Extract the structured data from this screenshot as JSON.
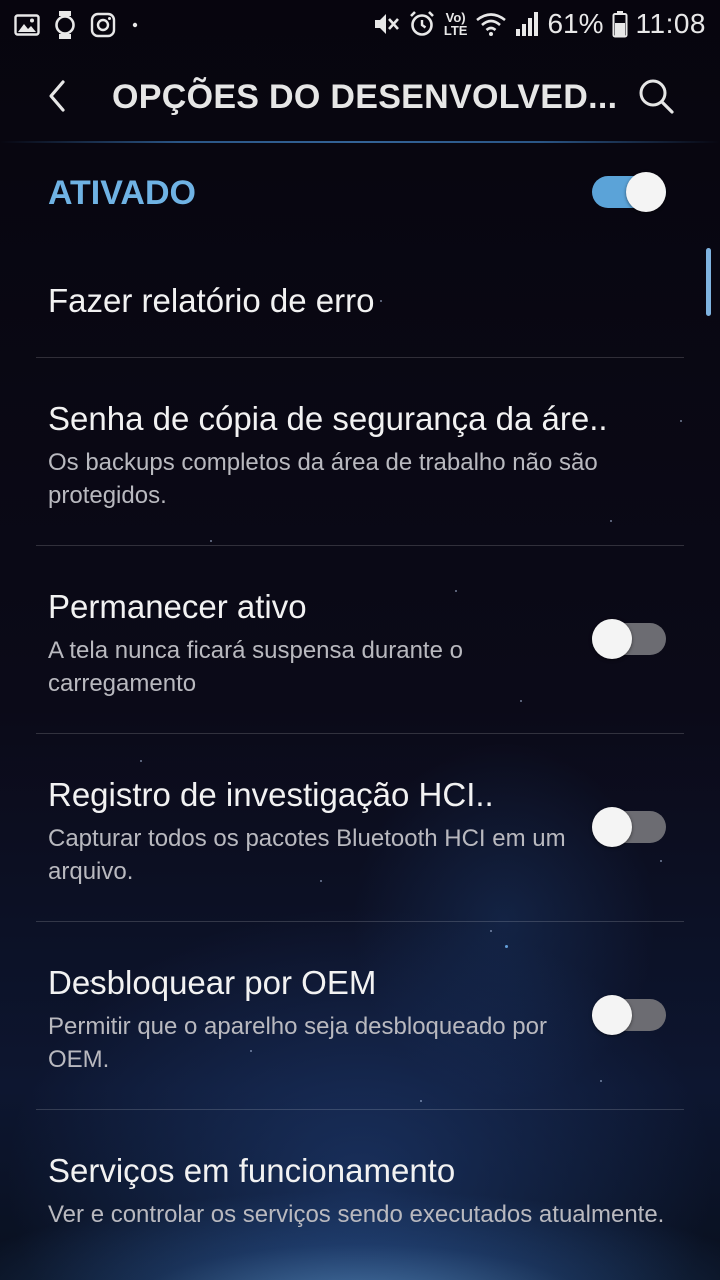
{
  "status_bar": {
    "left_icons": [
      "gallery-icon",
      "watch-icon",
      "instagram-icon",
      "dot-icon"
    ],
    "right_icons": [
      "mute-icon",
      "alarm-icon",
      "volte-icon",
      "wifi-icon",
      "signal-icon"
    ],
    "volte_top": "Vo)",
    "volte_bottom": "LTE",
    "battery_percent": "61%",
    "battery_level": 0.61,
    "time": "11:08"
  },
  "header": {
    "title": "OPÇÕES DO DESENVOLVED...",
    "back_icon": "back-arrow-icon",
    "search_icon": "search-icon"
  },
  "master_switch": {
    "label": "ATIVADO",
    "on": true
  },
  "settings": [
    {
      "title": "Fazer relatório de erro",
      "subtitle": "",
      "has_toggle": false
    },
    {
      "title": "Senha de cópia de segurança da áre..",
      "subtitle": "Os backups completos da área de trabalho não são protegidos.",
      "has_toggle": false
    },
    {
      "title": "Permanecer ativo",
      "subtitle": "A tela nunca ficará suspensa durante o carregamento",
      "has_toggle": true,
      "on": false
    },
    {
      "title": "Registro de investigação HCI..",
      "subtitle": "Capturar todos os pacotes Bluetooth HCI em um arquivo.",
      "has_toggle": true,
      "on": false
    },
    {
      "title": "Desbloquear por OEM",
      "subtitle": "Permitir que o aparelho seja desbloqueado por OEM.",
      "has_toggle": true,
      "on": false
    },
    {
      "title": "Serviços em funcionamento",
      "subtitle": "Ver e controlar os serviços sendo executados atualmente.",
      "has_toggle": false
    }
  ],
  "colors": {
    "accent": "#6fb2e4",
    "toggle_on": "#5ba3d8",
    "toggle_off": "#6c6c72"
  }
}
